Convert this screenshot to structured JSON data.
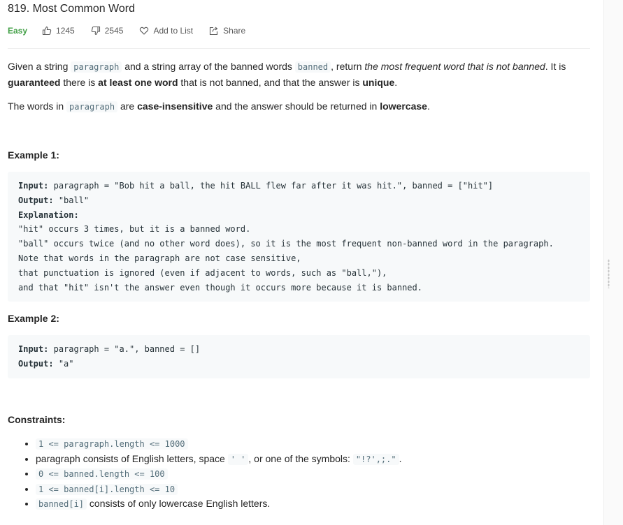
{
  "problem": {
    "title": "819. Most Common Word",
    "difficulty": "Easy",
    "likes": "1245",
    "dislikes": "2545",
    "add_to_list": "Add to List",
    "share": "Share"
  },
  "description": {
    "p1_a": "Given a string",
    "p1_code1": "paragraph",
    "p1_b": "and a string array of the banned words",
    "p1_code2": "banned",
    "p1_c": ", return",
    "p1_em": "the most frequent word that is not banned",
    "p1_d": ". It is",
    "p1_bold1": "guaranteed",
    "p1_e": "there is",
    "p1_bold2": "at least one word",
    "p1_f": "that is not banned, and that the answer is",
    "p1_bold3": "unique",
    "p1_g": ".",
    "p2_a": "The words in",
    "p2_code": "paragraph",
    "p2_b": "are",
    "p2_bold1": "case-insensitive",
    "p2_c": "and the answer should be returned in",
    "p2_bold2": "lowercase",
    "p2_d": "."
  },
  "example1": {
    "heading": "Example 1:",
    "input_label": "Input:",
    "input_value": "paragraph = \"Bob hit a ball, the hit BALL flew far after it was hit.\", banned = [\"hit\"]",
    "output_label": "Output:",
    "output_value": "\"ball\"",
    "explanation_label": "Explanation:",
    "explanation_lines": [
      "\"hit\" occurs 3 times, but it is a banned word.",
      "\"ball\" occurs twice (and no other word does), so it is the most frequent non-banned word in the paragraph.",
      "Note that words in the paragraph are not case sensitive,",
      "that punctuation is ignored (even if adjacent to words, such as \"ball,\"),",
      "and that \"hit\" isn't the answer even though it occurs more because it is banned."
    ]
  },
  "example2": {
    "heading": "Example 2:",
    "input_label": "Input:",
    "input_value": "paragraph = \"a.\", banned = []",
    "output_label": "Output:",
    "output_value": "\"a\""
  },
  "constraints": {
    "heading": "Constraints:",
    "c1_code": "1 <= paragraph.length <= 1000",
    "c2_a": "paragraph consists of English letters, space",
    "c2_code1": "' '",
    "c2_b": ", or one of the symbols:",
    "c2_code2": "\"!?',;.\"",
    "c2_c": ".",
    "c3_code": "0 <= banned.length <= 100",
    "c4_code": "1 <= banned[i].length <= 10",
    "c5_code": "banned[i]",
    "c5_b": "consists of only lowercase English letters."
  }
}
